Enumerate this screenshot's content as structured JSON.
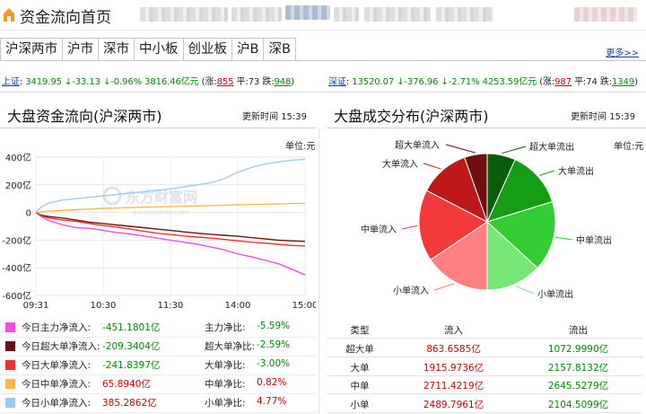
{
  "header": {
    "title": "资金流向首页"
  },
  "tabs": [
    "沪深两市",
    "沪市",
    "深市",
    "中小板",
    "创业板",
    "沪B",
    "深B"
  ],
  "more_link": "更多>>",
  "sh_index": {
    "name": "上证",
    "sep": ":",
    "price": "3419.95",
    "change": "↓-33.13",
    "pct": "↓-0.96%",
    "amount": "3816.46亿元",
    "open_label": "(涨:",
    "up": "855",
    "flat_label": "平:",
    "flat": "73",
    "down_label": "跌:",
    "down": "948",
    "close": ")"
  },
  "sz_index": {
    "name": "深证",
    "sep": ":",
    "price": "13520.07",
    "change": "↓-376.96",
    "pct": "↓-2.71%",
    "amount": "4253.59亿元",
    "open_label": "(涨:",
    "up": "987",
    "flat_label": "平:",
    "flat": "74",
    "down_label": "跌:",
    "down": "1349",
    "close": ")"
  },
  "left_panel": {
    "title": "大盘资金流向(沪深两市)",
    "update_label": "更新时间",
    "update_time": "15:39",
    "unit": "单位:元"
  },
  "right_panel": {
    "title": "大盘成交分布(沪深两市)",
    "update_label": "更新时间",
    "update_time": "15:39",
    "unit": "单位:元"
  },
  "chart_data": [
    {
      "type": "line",
      "title": "大盘资金流向(沪深两市)",
      "ylim": [
        -600,
        400
      ],
      "y_ticks": [
        "400亿",
        "200亿",
        "0",
        "-200亿",
        "-400亿",
        "-600亿"
      ],
      "y_tick_values": [
        400,
        200,
        0,
        -200,
        -400,
        -600
      ],
      "x_ticks": [
        "09:31",
        "10:30",
        "11:30",
        "14:00",
        "15:00"
      ],
      "watermark": "东方财富网",
      "watermark_sub": "eastmoney.com",
      "grid": true,
      "series": [
        {
          "name": "今日主力净流入",
          "color": "#f04ee0",
          "points": [
            [
              0,
              0
            ],
            [
              2,
              -30
            ],
            [
              5,
              -60
            ],
            [
              10,
              -90
            ],
            [
              15,
              -110
            ],
            [
              20,
              -115
            ],
            [
              25,
              -130
            ],
            [
              30,
              -145
            ],
            [
              35,
              -155
            ],
            [
              40,
              -170
            ],
            [
              45,
              -185
            ],
            [
              50,
              -200
            ],
            [
              55,
              -215
            ],
            [
              60,
              -230
            ],
            [
              65,
              -250
            ],
            [
              70,
              -270
            ],
            [
              75,
              -300
            ],
            [
              80,
              -320
            ],
            [
              85,
              -345
            ],
            [
              90,
              -370
            ],
            [
              95,
              -410
            ],
            [
              100,
              -451
            ]
          ]
        },
        {
          "name": "今日超大单净流入",
          "color": "#6b1111",
          "points": [
            [
              0,
              0
            ],
            [
              2,
              -20
            ],
            [
              5,
              -30
            ],
            [
              10,
              -40
            ],
            [
              15,
              -55
            ],
            [
              20,
              -70
            ],
            [
              25,
              -80
            ],
            [
              30,
              -90
            ],
            [
              35,
              -100
            ],
            [
              40,
              -110
            ],
            [
              45,
              -120
            ],
            [
              50,
              -130
            ],
            [
              55,
              -140
            ],
            [
              60,
              -150
            ],
            [
              65,
              -158
            ],
            [
              70,
              -165
            ],
            [
              75,
              -172
            ],
            [
              80,
              -182
            ],
            [
              85,
              -190
            ],
            [
              90,
              -200
            ],
            [
              95,
              -205
            ],
            [
              100,
              -209
            ]
          ]
        },
        {
          "name": "今日大单净流入",
          "color": "#f03030",
          "points": [
            [
              0,
              0
            ],
            [
              2,
              -25
            ],
            [
              5,
              -40
            ],
            [
              10,
              -55
            ],
            [
              15,
              -65
            ],
            [
              20,
              -80
            ],
            [
              25,
              -95
            ],
            [
              30,
              -105
            ],
            [
              35,
              -120
            ],
            [
              40,
              -135
            ],
            [
              45,
              -150
            ],
            [
              50,
              -160
            ],
            [
              55,
              -170
            ],
            [
              60,
              -178
            ],
            [
              65,
              -185
            ],
            [
              70,
              -195
            ],
            [
              75,
              -205
            ],
            [
              80,
              -215
            ],
            [
              85,
              -222
            ],
            [
              90,
              -230
            ],
            [
              95,
              -238
            ],
            [
              100,
              -242
            ]
          ]
        },
        {
          "name": "今日中单净流入",
          "color": "#f7b84b",
          "points": [
            [
              0,
              0
            ],
            [
              2,
              5
            ],
            [
              5,
              10
            ],
            [
              10,
              15
            ],
            [
              15,
              20
            ],
            [
              20,
              25
            ],
            [
              25,
              30
            ],
            [
              30,
              32
            ],
            [
              35,
              35
            ],
            [
              40,
              38
            ],
            [
              45,
              40
            ],
            [
              50,
              42
            ],
            [
              55,
              45
            ],
            [
              60,
              48
            ],
            [
              65,
              50
            ],
            [
              70,
              52
            ],
            [
              75,
              55
            ],
            [
              80,
              58
            ],
            [
              85,
              60
            ],
            [
              90,
              62
            ],
            [
              95,
              64
            ],
            [
              100,
              66
            ]
          ]
        },
        {
          "name": "今日小单净流入",
          "color": "#9fcaf0",
          "points": [
            [
              0,
              0
            ],
            [
              2,
              40
            ],
            [
              5,
              70
            ],
            [
              10,
              90
            ],
            [
              15,
              100
            ],
            [
              20,
              110
            ],
            [
              25,
              120
            ],
            [
              30,
              130
            ],
            [
              35,
              140
            ],
            [
              40,
              150
            ],
            [
              45,
              160
            ],
            [
              50,
              170
            ],
            [
              55,
              185
            ],
            [
              60,
              200
            ],
            [
              65,
              215
            ],
            [
              70,
              245
            ],
            [
              75,
              290
            ],
            [
              80,
              325
            ],
            [
              85,
              350
            ],
            [
              90,
              365
            ],
            [
              95,
              378
            ],
            [
              100,
              385
            ]
          ]
        }
      ],
      "legend": [
        {
          "color": "#f04ee0",
          "name": "今日主力净流入:",
          "value": "-451.1801亿",
          "ratio_label": "主力净比:",
          "ratio": "-5.59%",
          "value_color": "#008a00",
          "ratio_color": "#008a00"
        },
        {
          "color": "#6b1111",
          "name": "今日超大单净流入:",
          "value": "-209.3404亿",
          "ratio_label": "超大单净比:",
          "ratio": "-2.59%",
          "value_color": "#008a00",
          "ratio_color": "#008a00"
        },
        {
          "color": "#f03030",
          "name": "今日大单净流入:",
          "value": "-241.8397亿",
          "ratio_label": "大单净比:",
          "ratio": "-3.00%",
          "value_color": "#008a00",
          "ratio_color": "#008a00"
        },
        {
          "color": "#f7b84b",
          "name": "今日中单净流入:",
          "value": "65.8940亿",
          "ratio_label": "中单净比:",
          "ratio": "0.82%",
          "value_color": "#d40000",
          "ratio_color": "#d40000"
        },
        {
          "color": "#9fcaf0",
          "name": "今日小单净流入:",
          "value": "385.2862亿",
          "ratio_label": "小单净比:",
          "ratio": "4.77%",
          "value_color": "#d40000",
          "ratio_color": "#d40000"
        }
      ]
    },
    {
      "type": "pie",
      "title": "大盘成交分布(沪深两市)",
      "slices": [
        {
          "label": "超大单流出",
          "value": 1072.999,
          "color": "#0a5c0a"
        },
        {
          "label": "大单流出",
          "value": 2157.8132,
          "color": "#159e15"
        },
        {
          "label": "中单流出",
          "value": 2645.5279,
          "color": "#33cc33"
        },
        {
          "label": "小单流出",
          "value": 2104.5099,
          "color": "#77e877"
        },
        {
          "label": "小单流入",
          "value": 2489.7961,
          "color": "#ff8080"
        },
        {
          "label": "中单流入",
          "value": 2711.4219,
          "color": "#f23a3a"
        },
        {
          "label": "大单流入",
          "value": 1915.9736,
          "color": "#c01818"
        },
        {
          "label": "超大单流入",
          "value": 863.6585,
          "color": "#6d1010"
        }
      ]
    },
    {
      "type": "table",
      "headers": [
        "类型",
        "流入",
        "流出"
      ],
      "rows": [
        [
          "超大单",
          "863.6585亿",
          "1072.9990亿"
        ],
        [
          "大单",
          "1915.9736亿",
          "2157.8132亿"
        ],
        [
          "中单",
          "2711.4219亿",
          "2645.5279亿"
        ],
        [
          "小单",
          "2489.7961亿",
          "2104.5099亿"
        ]
      ]
    }
  ],
  "colors": {
    "up": "#d40000",
    "down": "#008a00",
    "link": "#1a3fa8"
  }
}
